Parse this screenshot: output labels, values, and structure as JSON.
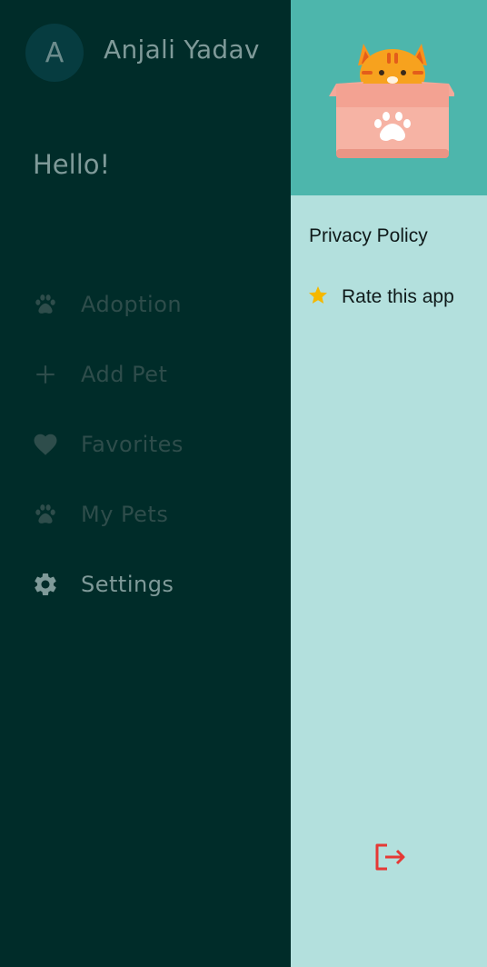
{
  "drawer": {
    "avatar_letter": "A",
    "username": "Anjali Yadav",
    "greeting": "Hello!",
    "items": [
      {
        "label": "Adoption",
        "icon": "paw-icon",
        "state": "dim"
      },
      {
        "label": "Add Pet",
        "icon": "plus-icon",
        "state": "dim"
      },
      {
        "label": "Favorites",
        "icon": "heart-icon",
        "state": "dim"
      },
      {
        "label": "My Pets",
        "icon": "paw-icon",
        "state": "dim"
      },
      {
        "label": "Settings",
        "icon": "gear-icon",
        "state": "active"
      }
    ]
  },
  "panel": {
    "header_image": "cat-in-box-illustration",
    "privacy_label": "Privacy Policy",
    "rate_label": "Rate this app",
    "rate_icon": "star-icon",
    "logout_icon": "logout-icon"
  },
  "colors": {
    "drawer_bg": "#002c29",
    "header_bg": "#4db6ac",
    "panel_bg": "#b3e0dd",
    "star": "#f5b800",
    "logout": "#e53935"
  }
}
